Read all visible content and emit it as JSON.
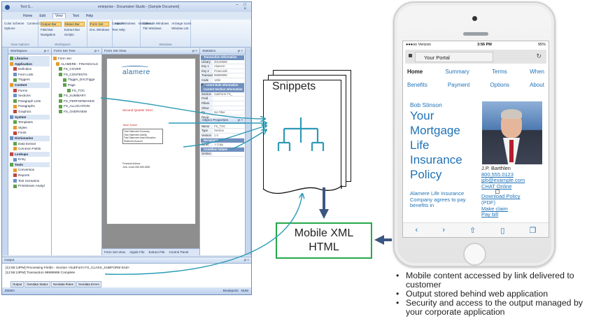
{
  "desktop_app": {
    "title": "enterprise - Documaker Studio - [Sample Document]",
    "title_tab": "Text S...",
    "window_buttons": "– □ ×",
    "menu_tabs": [
      "Home",
      "Edit",
      "View",
      "Text",
      "Help"
    ],
    "active_menu_tab": "View",
    "ribbon_groups": [
      {
        "name": "View Options",
        "items": [
          "Color Scheme",
          "Context Color",
          "Options"
        ]
      },
      {
        "name": "Workspace",
        "items": [
          "Output Bar",
          "Status Bar",
          "Field Bar",
          "Extract Bar",
          "Navigation",
          "Scripts"
        ]
      },
      {
        "name": "",
        "items": [
          "Form Set",
          "Controls",
          "DAL Windows",
          "Text Help"
        ]
      },
      {
        "name": "",
        "items": [
          "Input Windows",
          "Variables"
        ]
      },
      {
        "name": "Windows",
        "items": [
          "Cascade Windows",
          "Arrange Icons",
          "Tile Windows",
          "Window List"
        ]
      }
    ],
    "workspace_header": "Workspace",
    "doc_tab": "Sample Document",
    "workspace_items": [
      {
        "label": "Libraries",
        "type": "section"
      },
      {
        "label": "Application",
        "type": "section"
      },
      {
        "label": "Definition",
        "type": "item"
      },
      {
        "label": "Form Lists",
        "type": "item"
      },
      {
        "label": "Triggers",
        "type": "item"
      },
      {
        "label": "Content",
        "type": "section"
      },
      {
        "label": "Forms",
        "type": "item"
      },
      {
        "label": "Sections",
        "type": "item"
      },
      {
        "label": "Paragraph Lists",
        "type": "item"
      },
      {
        "label": "Paragraphs",
        "type": "item"
      },
      {
        "label": "Graphics",
        "type": "item"
      },
      {
        "label": "System",
        "type": "section"
      },
      {
        "label": "Templates",
        "type": "item"
      },
      {
        "label": "Styles",
        "type": "item"
      },
      {
        "label": "Fonts",
        "type": "item"
      },
      {
        "label": "Dictionaries",
        "type": "section"
      },
      {
        "label": "Data Extract",
        "type": "item"
      },
      {
        "label": "Common Fields",
        "type": "item"
      },
      {
        "label": "Lookups",
        "type": "section"
      },
      {
        "label": "Entry",
        "type": "item"
      },
      {
        "label": "Tools",
        "type": "section"
      },
      {
        "label": "Conversion",
        "type": "item"
      },
      {
        "label": "Reports",
        "type": "item"
      },
      {
        "label": "Test Scenarios",
        "type": "item"
      },
      {
        "label": "Printstream Analyz",
        "type": "item"
      }
    ],
    "form_set_tree_header": "Form Set Tree",
    "form_set_tree": [
      "Form Set",
      "ALAMERE - FINANCIALS",
      "FS_COVER",
      "FS_CONTENTS",
      "Trigger_DALTrigge",
      "Page",
      "FS_TOC",
      "FS_SUMMARY",
      "FS_PERFORMANCE",
      "FS_ALLOCATION",
      "FS_OVERVIEW"
    ],
    "form_set_view_header": "Form Set View",
    "preview": {
      "logo": "alamere",
      "red_text": "Second Quarter 2014",
      "small_red": "Table Name",
      "box_lines": [
        "Total Statement Summary",
        "Total Statement Activity",
        "Total Statement Asset Allocation",
        "Statement Account"
      ],
      "bottom_lines": [
        "Financial Advisor",
        "John Jones    555-555-5555"
      ]
    },
    "form_view_tabs": [
      "Form Set View",
      "AlgIdx File",
      "Extract File",
      "Control Panel"
    ],
    "statistics_header": "Statistics",
    "statistics_rows": [
      {
        "key": "Library ID",
        "value": "20140606"
      },
      {
        "key": "Key 1",
        "value": "Alamere"
      },
      {
        "key": "Key 2",
        "value": "Financials"
      },
      {
        "key": "Transact",
        "value": "99999999"
      },
      {
        "key": "Code Pag",
        "value": "1252"
      }
    ],
    "statistics_cats": [
      "Transaction Information",
      "Current Rule Information",
      "Current Section Information"
    ],
    "current_section_rows": [
      {
        "key": "Section",
        "value": "SubForm FS_"
      },
      {
        "key": "Field",
        "value": ""
      },
      {
        "key": "Filters",
        "value": ""
      },
      {
        "key": "Show No",
        "value": ""
      },
      {
        "key": "By Recip",
        "value": "No Filter"
      }
    ],
    "object_props_header": "Object Properties",
    "object_props_rows": [
      {
        "key": "Name",
        "value": "FS_TOC"
      },
      {
        "key": "Type",
        "value": "Section"
      },
      {
        "key": "Version",
        "value": "1.0"
      }
    ],
    "object_props_cats": [
      "Recipients",
      "Condition Values"
    ],
    "object_props_more": [
      {
        "key": "Other",
        "value": "1 Copy"
      },
      {
        "key": "GetSec",
        "value": ""
      }
    ],
    "output_header": "Output",
    "output_lines": [
      "[12:55:13PM] Processing Fields - Section <SubForm FS_CLASS_SUBFORM End>",
      "[12:55:13PM] Transaction 99999999 Complete"
    ],
    "output_tabs": [
      "Output",
      "Gendata Status",
      "Gendata Rules",
      "Gendata Errors"
    ],
    "status_left": "DEMO",
    "status_right": "Breakpoint",
    "status_num": "NUM"
  },
  "diagram": {
    "snippets_label": "Snippets",
    "mobile_box_line1": "Mobile XML",
    "mobile_box_line2": "HTML",
    "bullets": [
      "Mobile content accessed by link delivered to customer",
      "Output stored behind web application",
      "Security and access to the output managed by your corporate application"
    ],
    "colors": {
      "arrow_teal": "#2b9bb5",
      "arrow_navy": "#3b5680",
      "box_green": "#27a84a",
      "link_blue": "#1f72b7"
    }
  },
  "phone": {
    "carrier": "●●●oo Verizon",
    "time": "3:56 PM",
    "battery": "95%",
    "url_tab": "Your Portal",
    "nav_row1": [
      "Home",
      "Summary",
      "Terms",
      "When"
    ],
    "nav_row2": [
      "Benefits",
      "Payment",
      "Options",
      "About"
    ],
    "customer_name": "Bob Stinson",
    "headline": [
      "Your",
      "Mortgage",
      "Life",
      "Insurance",
      "Policy"
    ],
    "agent_name": "J.P. Barthlen",
    "agent_phone": "800.555.0123",
    "agent_email": "jpb@example.com",
    "agent_chat": "CHAT Online",
    "links": [
      "Download Policy",
      "(PDF)",
      "Make claim",
      "Pay bill"
    ],
    "company_text": "Alamere Life Insurance Company agrees to pay benefits in",
    "bottom_icons": [
      "back-icon",
      "forward-icon",
      "share-icon",
      "bookmarks-icon",
      "tabs-icon"
    ],
    "bottom_glyphs": [
      "‹",
      "›",
      "⇧",
      "▯",
      "❐"
    ]
  }
}
